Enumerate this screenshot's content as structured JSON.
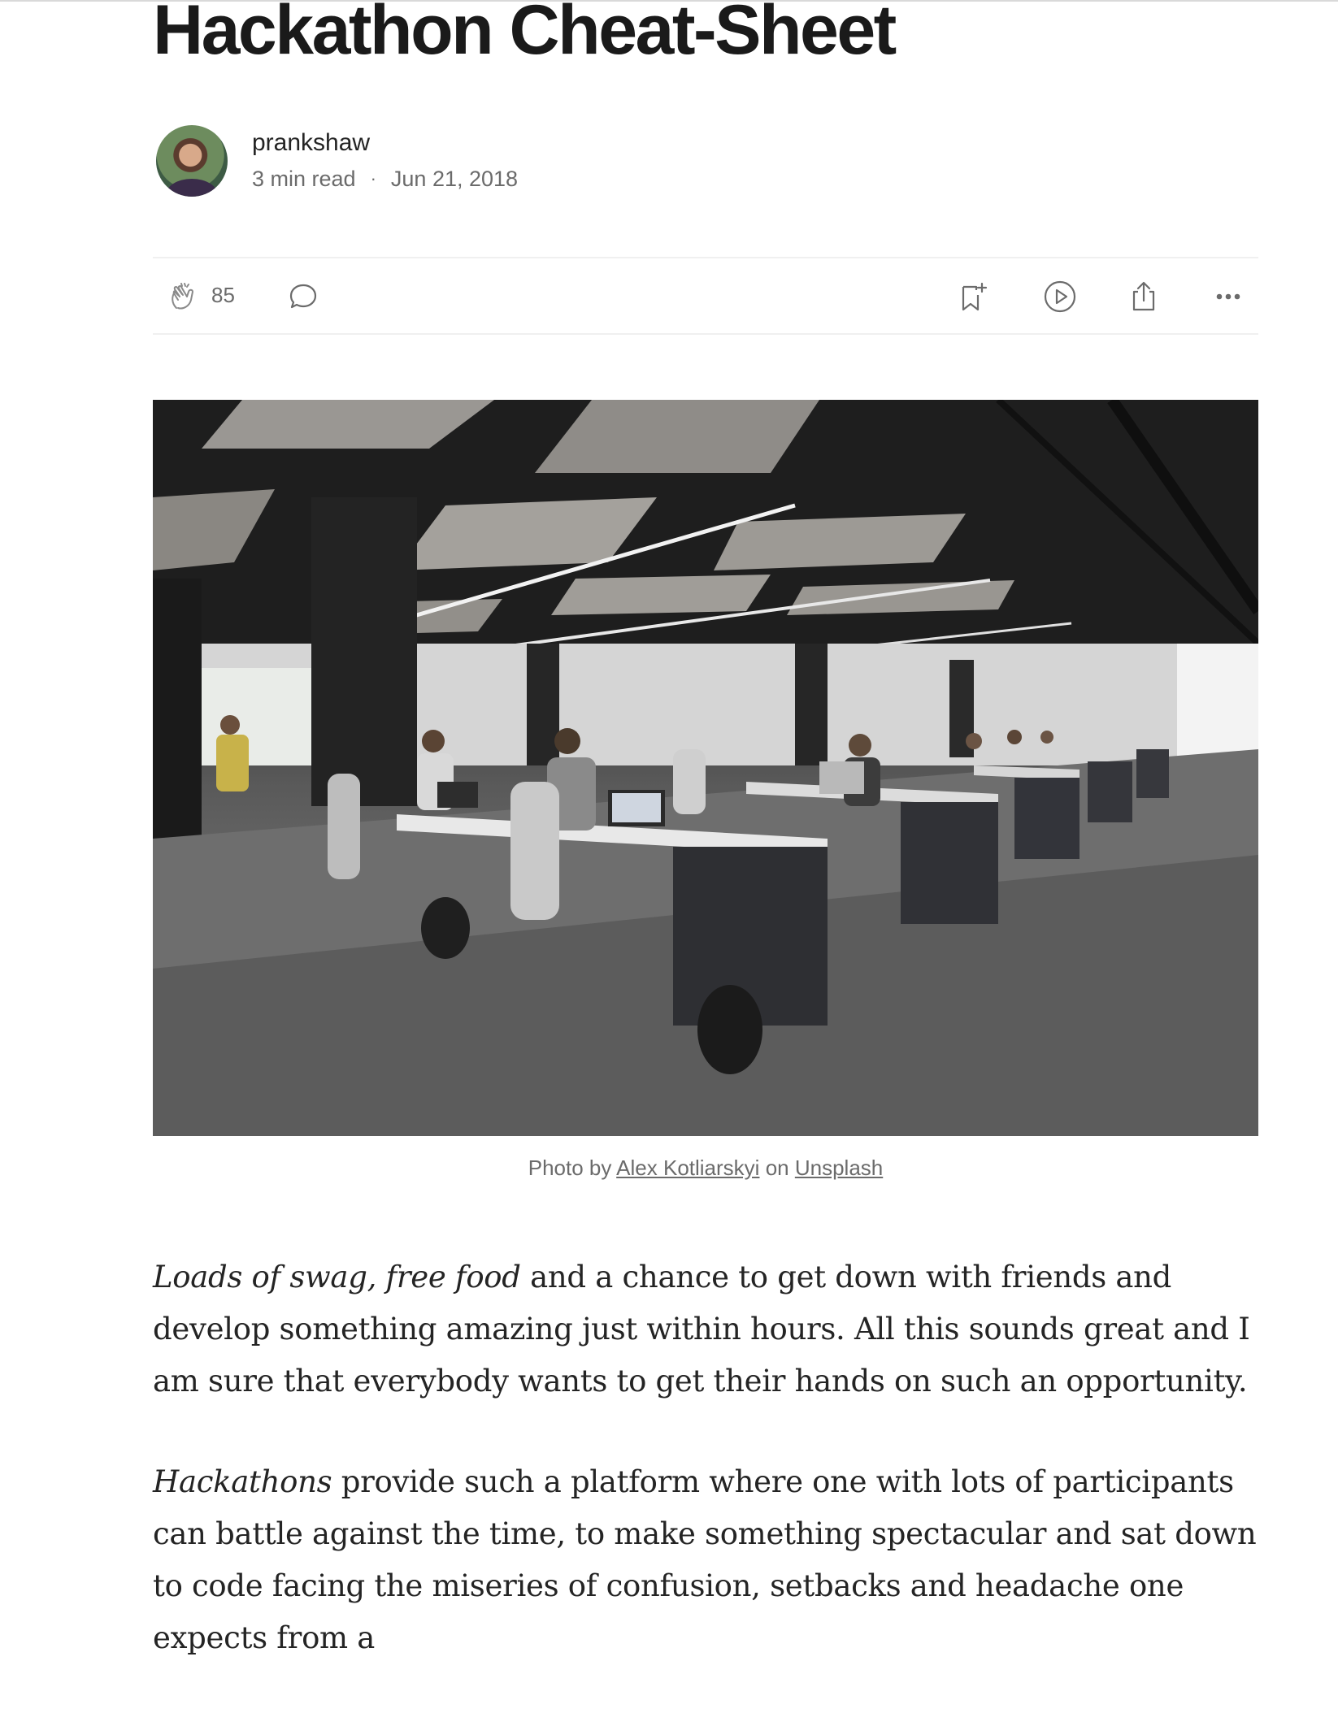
{
  "article": {
    "title": "Hackathon Cheat-Sheet",
    "author": {
      "name": "prankshaw",
      "read_time": "3 min read",
      "separator": "·",
      "date": "Jun 21, 2018"
    },
    "actions": {
      "clap_count": "85",
      "icons": [
        "clap-icon",
        "comment-icon",
        "bookmark-add-icon",
        "play-icon",
        "share-icon",
        "more-icon"
      ]
    },
    "hero_caption": {
      "prefix": "Photo by",
      "photographer": "Alex Kotliarskyi",
      "middle": "on",
      "source": "Unsplash"
    },
    "paragraphs": [
      {
        "em": "Loads of swag, free food",
        "rest": " and a chance to get down with friends and develop something amazing just within hours. All this sounds great and I am sure that everybody wants to get their hands on such an opportunity."
      },
      {
        "em": "Hackathons",
        "rest": " provide such a platform where one with lots of participants can battle against the time, to make something spectacular and sat down to code facing the miseries of confusion, setbacks and headache one expects from a"
      }
    ]
  },
  "colors": {
    "text": "#242424",
    "muted": "#6b6b6b",
    "divider": "#f0f0f0"
  }
}
